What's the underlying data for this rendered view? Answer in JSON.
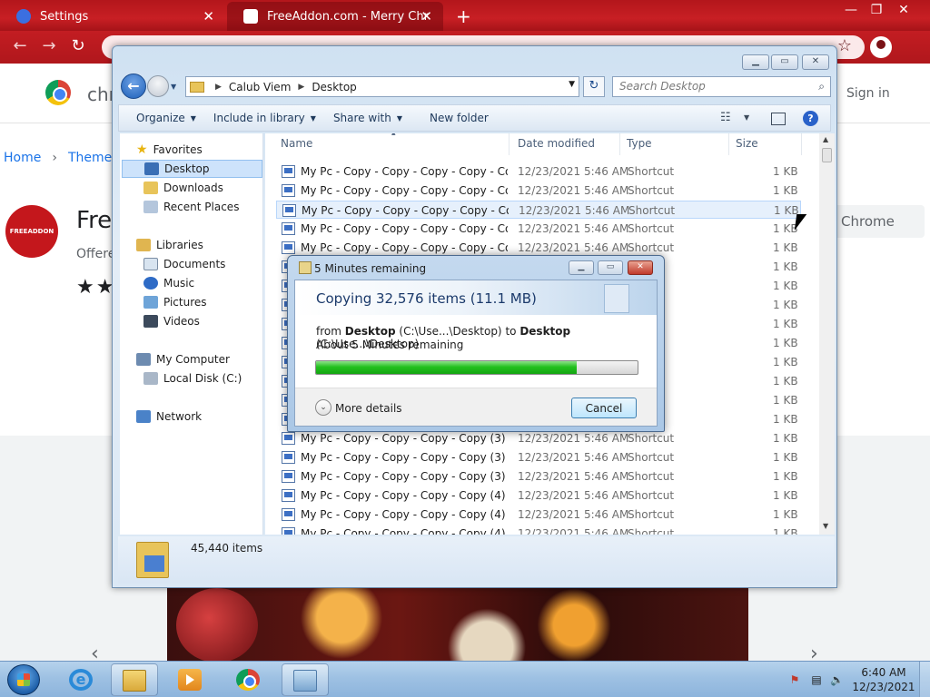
{
  "chrome": {
    "tabs": [
      {
        "title": "Settings",
        "active": false
      },
      {
        "title": "FreeAddon.com - Merry Christm",
        "active": true
      }
    ],
    "new_tab_label": "+",
    "window_controls": {
      "minimize": "—",
      "restore": "❐",
      "close": "✕"
    },
    "nav": {
      "back": "←",
      "forward": "→",
      "reload": "↻"
    },
    "star_icon": "☆"
  },
  "store": {
    "name": "chr",
    "signin": "Sign in",
    "breadcrumb": {
      "home": "Home",
      "sep": "›",
      "current": "Themes"
    },
    "ext_logo_text": "FREEADDON",
    "ext_title": "Fre",
    "offered": "Offere",
    "stars": "★★",
    "add_button": "Chrome",
    "carousel": {
      "prev": "‹",
      "next": "›"
    }
  },
  "explorer": {
    "captions": {
      "minimize": "▁",
      "maximize": "▭",
      "close": "✕"
    },
    "back_icon": "←",
    "address": {
      "crumbs": [
        "Calub Viem",
        "Desktop"
      ],
      "sep": "▶",
      "dropdown": "▼"
    },
    "refresh_icon": "↻",
    "search": {
      "placeholder": "Search Desktop",
      "icon": "⌕"
    },
    "commands": [
      {
        "label": "Organize",
        "dropdown": true
      },
      {
        "label": "Include in library",
        "dropdown": true
      },
      {
        "label": "Share with",
        "dropdown": true
      },
      {
        "label": "New folder",
        "dropdown": false
      }
    ],
    "view_icon": "☷",
    "help_icon": "?",
    "nav": {
      "favorites": "Favorites",
      "desktop": "Desktop",
      "downloads": "Downloads",
      "recent": "Recent Places",
      "libraries": "Libraries",
      "documents": "Documents",
      "music": "Music",
      "pictures": "Pictures",
      "videos": "Videos",
      "computer": "My Computer",
      "local_disk": "Local Disk (C:)",
      "network": "Network"
    },
    "columns": {
      "name": "Name",
      "date": "Date modified",
      "type": "Type",
      "size": "Size"
    },
    "files": [
      {
        "name": "My Pc - Copy - Copy - Copy - Copy - Co...",
        "date": "12/23/2021 5:46 AM",
        "type": "Shortcut",
        "size": "1 KB"
      },
      {
        "name": "My Pc - Copy - Copy - Copy - Copy - Co...",
        "date": "12/23/2021 5:46 AM",
        "type": "Shortcut",
        "size": "1 KB"
      },
      {
        "name": "My Pc - Copy - Copy - Copy - Copy - Co...",
        "date": "12/23/2021 5:46 AM",
        "type": "Shortcut",
        "size": "1 KB"
      },
      {
        "name": "My Pc - Copy - Copy - Copy - Copy - Co...",
        "date": "12/23/2021 5:46 AM",
        "type": "Shortcut",
        "size": "1 KB"
      },
      {
        "name": "My Pc - Copy - Copy - Copy - Copy - Co...",
        "date": "12/23/2021 5:46 AM",
        "type": "Shortcut",
        "size": "1 KB"
      },
      {
        "name": "",
        "date": "",
        "type": "",
        "size": "1 KB"
      },
      {
        "name": "",
        "date": "",
        "type": "",
        "size": "1 KB"
      },
      {
        "name": "",
        "date": "",
        "type": "",
        "size": "1 KB"
      },
      {
        "name": "",
        "date": "",
        "type": "",
        "size": "1 KB"
      },
      {
        "name": "",
        "date": "",
        "type": "",
        "size": "1 KB"
      },
      {
        "name": "",
        "date": "",
        "type": "",
        "size": "1 KB"
      },
      {
        "name": "",
        "date": "",
        "type": "",
        "size": "1 KB"
      },
      {
        "name": "",
        "date": "",
        "type": "",
        "size": "1 KB"
      },
      {
        "name": "",
        "date": "",
        "type": "",
        "size": "1 KB"
      },
      {
        "name": "My Pc - Copy - Copy - Copy - Copy (3) - ...",
        "date": "12/23/2021 5:46 AM",
        "type": "Shortcut",
        "size": "1 KB"
      },
      {
        "name": "My Pc - Copy - Copy - Copy - Copy (3) - ...",
        "date": "12/23/2021 5:46 AM",
        "type": "Shortcut",
        "size": "1 KB"
      },
      {
        "name": "My Pc - Copy - Copy - Copy - Copy (3)",
        "date": "12/23/2021 5:46 AM",
        "type": "Shortcut",
        "size": "1 KB"
      },
      {
        "name": "My Pc - Copy - Copy - Copy - Copy (4) - ...",
        "date": "12/23/2021 5:46 AM",
        "type": "Shortcut",
        "size": "1 KB"
      },
      {
        "name": "My Pc - Copy - Copy - Copy - Copy (4) - ...",
        "date": "12/23/2021 5:46 AM",
        "type": "Shortcut",
        "size": "1 KB"
      },
      {
        "name": "My Pc - Copy - Copy - Copy - Copy (4)",
        "date": "12/23/2021 5:46 AM",
        "type": "Shortcut",
        "size": "1 KB"
      }
    ],
    "scroll": {
      "up": "▲",
      "down": "▼"
    },
    "item_count": "45,440 items"
  },
  "copy_dialog": {
    "title": "5 Minutes remaining",
    "captions": {
      "minimize": "▁",
      "maximize": "▭",
      "close": "✕"
    },
    "heading": "Copying 32,576 items (11.1 MB)",
    "from_word": "from",
    "from_name": "Desktop",
    "from_path": "(C:\\Use...\\Desktop)",
    "to_word": "to",
    "to_name": "Desktop",
    "to_path": "(C:\\Use...\\Desktop)",
    "remaining": "About 5 Minutes remaining",
    "progress": 0.81,
    "more_icon": "⌄",
    "more_details": "More details",
    "cancel": "Cancel"
  },
  "taskbar": {
    "ie_letter": "e",
    "tray": {
      "flag": "⚑",
      "network": "▤",
      "volume": "🔈"
    },
    "time": "6:40 AM",
    "date": "12/23/2021"
  }
}
